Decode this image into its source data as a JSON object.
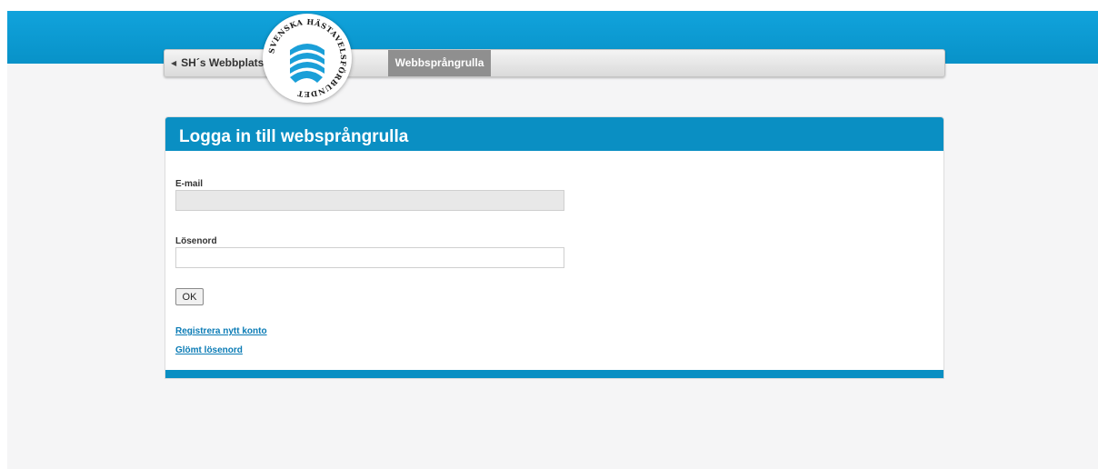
{
  "nav": {
    "back_label": "SH´s Webbplats",
    "active_tab": "Webbsprångrulla"
  },
  "logo": {
    "ring_text": "SVENSKA HÄSTAVELSFÖRBUNDET"
  },
  "login": {
    "title": "Logga in till websprångrulla",
    "email_label": "E-mail",
    "email_value": "",
    "password_label": "Lösenord",
    "password_value": "",
    "ok_label": "OK",
    "register_link": "Registrera nytt konto",
    "forgot_link": "Glömt lösenord"
  },
  "colors": {
    "brand_blue": "#0a8fc3",
    "top_band": "#11a3dc",
    "link": "#0a7bb5"
  }
}
